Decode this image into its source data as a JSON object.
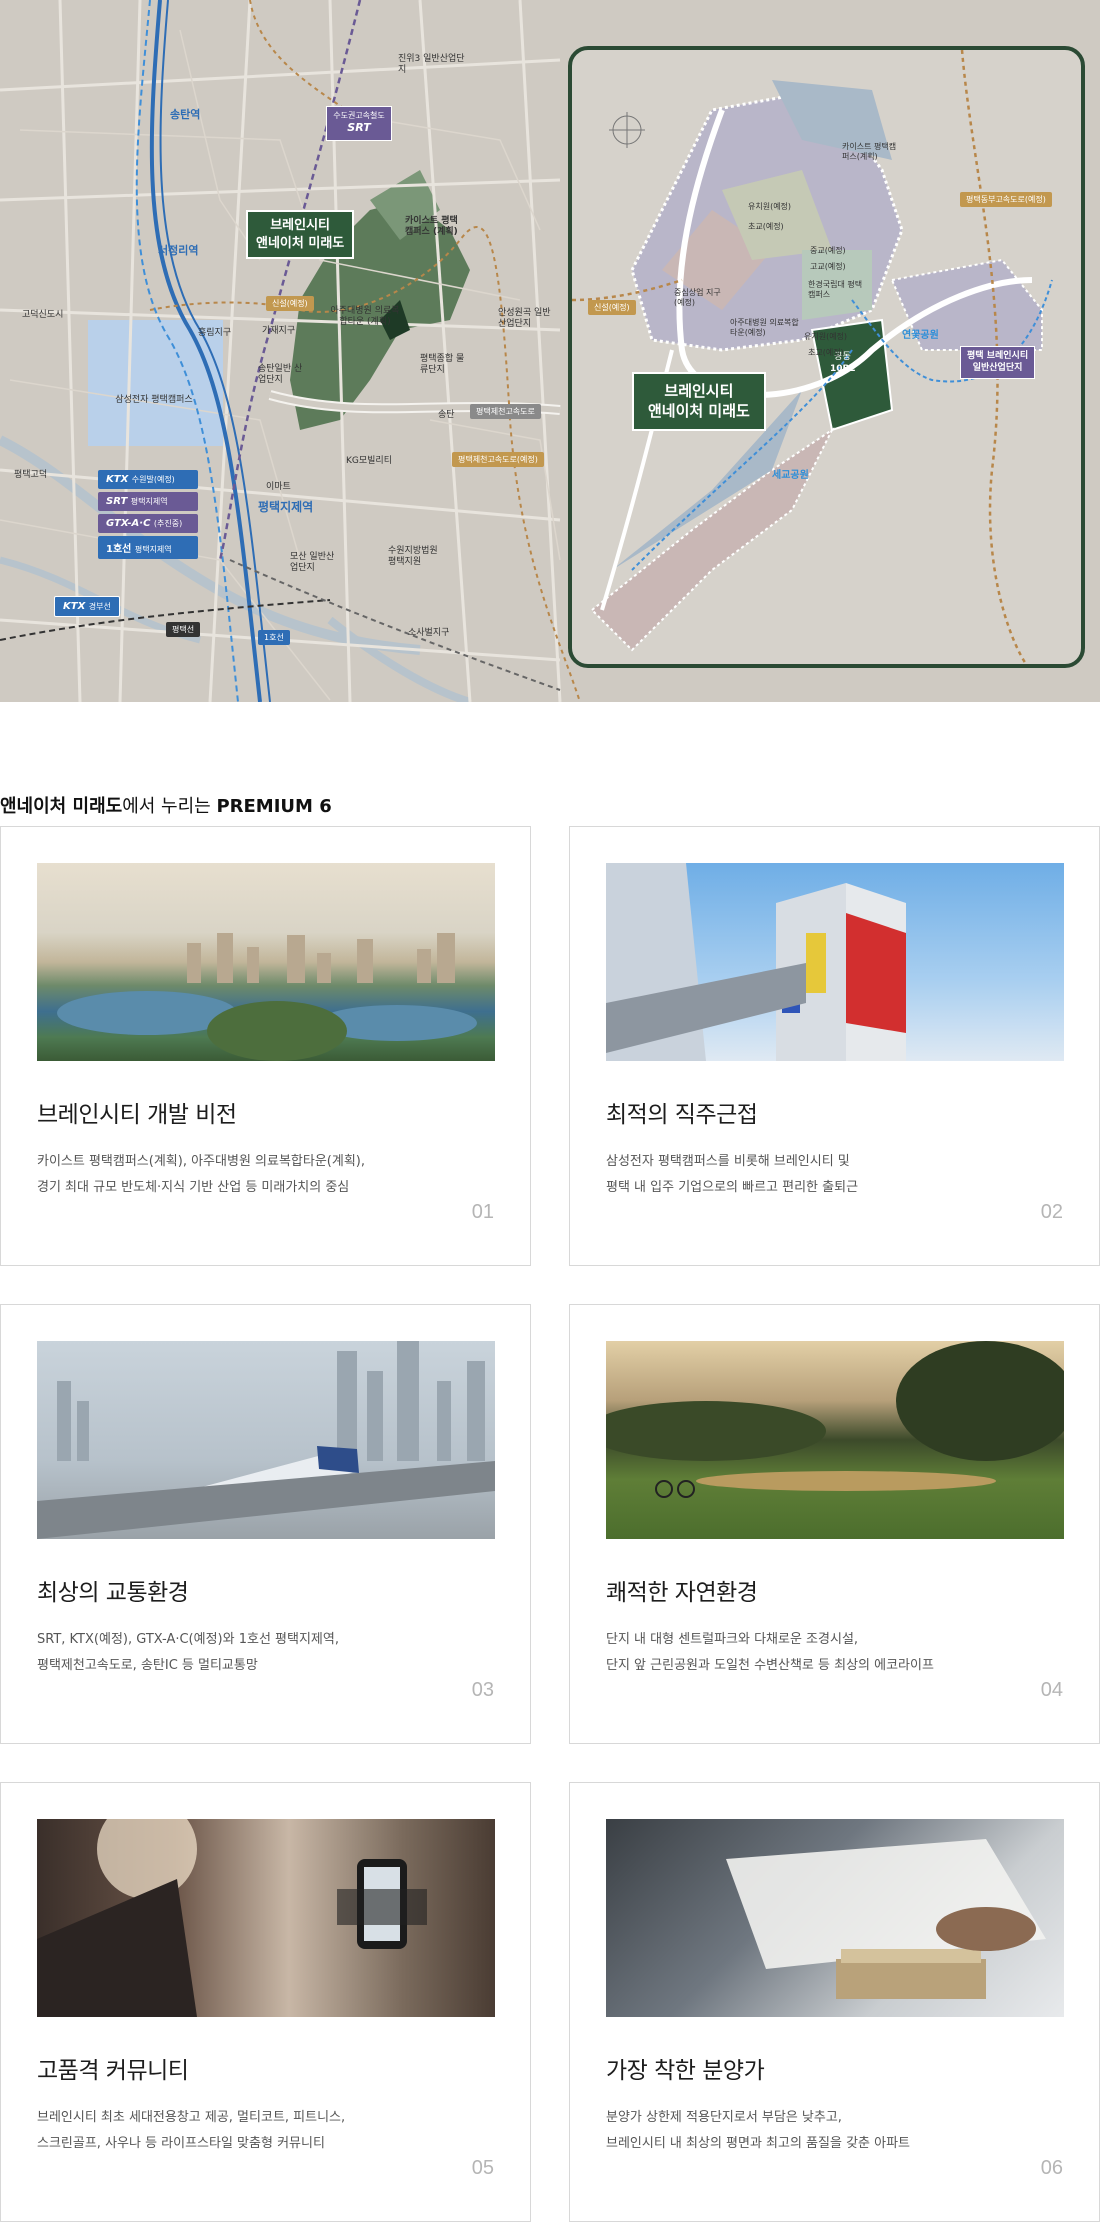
{
  "map": {
    "stations": [
      "송탄역",
      "서정리역",
      "평택지제역"
    ],
    "places": [
      "진위3 일반산업단지",
      "카이스트 평택캠퍼스 (계획)",
      "고덕신도시",
      "흥림지구",
      "가재지구",
      "삼성전자 평택캠퍼스",
      "아주대병원 의료복합타운 (계획)",
      "송탄일반 산업단지",
      "평택종합 물류단지",
      "안성원곡 일반산업단지",
      "KG모빌리티",
      "이마트",
      "송탄",
      "평택고덕",
      "수원지방법원 평택지원",
      "소사벌지구",
      "모산 일반산업단지"
    ],
    "srt_badge": {
      "title": "수도권고속철도",
      "logo": "SRT"
    },
    "main_label": [
      "브레인시티",
      "앤네이처 미래도"
    ],
    "rail_legend": [
      {
        "logo": "KTX",
        "text": "수원발(예정)"
      },
      {
        "logo": "SRT",
        "text": "평택지제역"
      },
      {
        "logo": "GTX-A·C",
        "text": "(추진중)"
      },
      {
        "logo": "1호선",
        "text": "평택지제역"
      }
    ],
    "ktx_line": {
      "logo": "KTX",
      "text": "경부선"
    },
    "line_tags": [
      "평택선",
      "1호선"
    ],
    "road_tags": [
      "신설(예정)",
      "평택제천고속도로",
      "평택제천고속도로(예정)"
    ],
    "inset": {
      "main_label": [
        "브레인시티",
        "앤네이처 미래도"
      ],
      "road_tag_top": "평택동부고속도로(예정)",
      "road_tag_left": "신설(예정)",
      "parcel": [
        "공동",
        "10BL"
      ],
      "purple_label": [
        "평택 브레인시티",
        "일반산업단지"
      ],
      "water1": "연꽃공원",
      "water2": "세교공원",
      "places": [
        "카이스트 평택캠퍼스(계획)",
        "유치원(예정)",
        "초교(예정)",
        "중교(예정)",
        "고교(예정)",
        "한경국립대 평택캠퍼스",
        "중심상업 지구(예정)",
        "아주대병원 의료복합타운(예정)",
        "유치원(예정)",
        "초교(예정)"
      ]
    }
  },
  "section": {
    "title_bold": "앤네이처 미래도",
    "title_mid": "에서 누리는 ",
    "title_premium": "PREMIUM 6"
  },
  "cards": [
    {
      "title": "브레인시티 개발 비전",
      "line1": "카이스트 평택캠퍼스(계획), 아주대병원 의료복합타운(계획),",
      "line2": "경기 최대 규모 반도체·지식 기반 산업 등 미래가치의 중심",
      "num": "01",
      "image": "lake-city-photo"
    },
    {
      "title": "최적의 직주근접",
      "line1": "삼성전자 평택캠퍼스를 비롯해 브레인시티 및",
      "line2": "평택 내 입주 기업으로의 빠르고 편리한 출퇴근",
      "num": "02",
      "image": "factory-building-photo"
    },
    {
      "title": "최상의 교통환경",
      "line1": "SRT, KTX(예정), GTX-A·C(예정)와 1호선 평택지제역,",
      "line2": "평택제천고속도로, 송탄IC 등 멀티교통망",
      "num": "03",
      "image": "train-photo"
    },
    {
      "title": "쾌적한 자연환경",
      "line1": "단지 내 대형 센트럴파크와 다채로운 조경시설,",
      "line2": "단지 앞 근린공원과 도일천 수변산책로 등 최상의 에코라이프",
      "num": "04",
      "image": "park-photo"
    },
    {
      "title": "고품격 커뮤니티",
      "line1": "브레인시티 최초 세대전용창고 제공, 멀티코트, 피트니스,",
      "line2": "스크린골프, 사우나 등 라이프스타일 맞춤형 커뮤니티",
      "num": "05",
      "image": "fitness-photo"
    },
    {
      "title": "가장 착한 분양가",
      "line1": "분양가 상한제 적용단지로서 부담은 낮추고,",
      "line2": "브레인시티 내 최상의 평면과 최고의 품질을 갖춘 아파트",
      "num": "06",
      "image": "money-photo"
    }
  ]
}
